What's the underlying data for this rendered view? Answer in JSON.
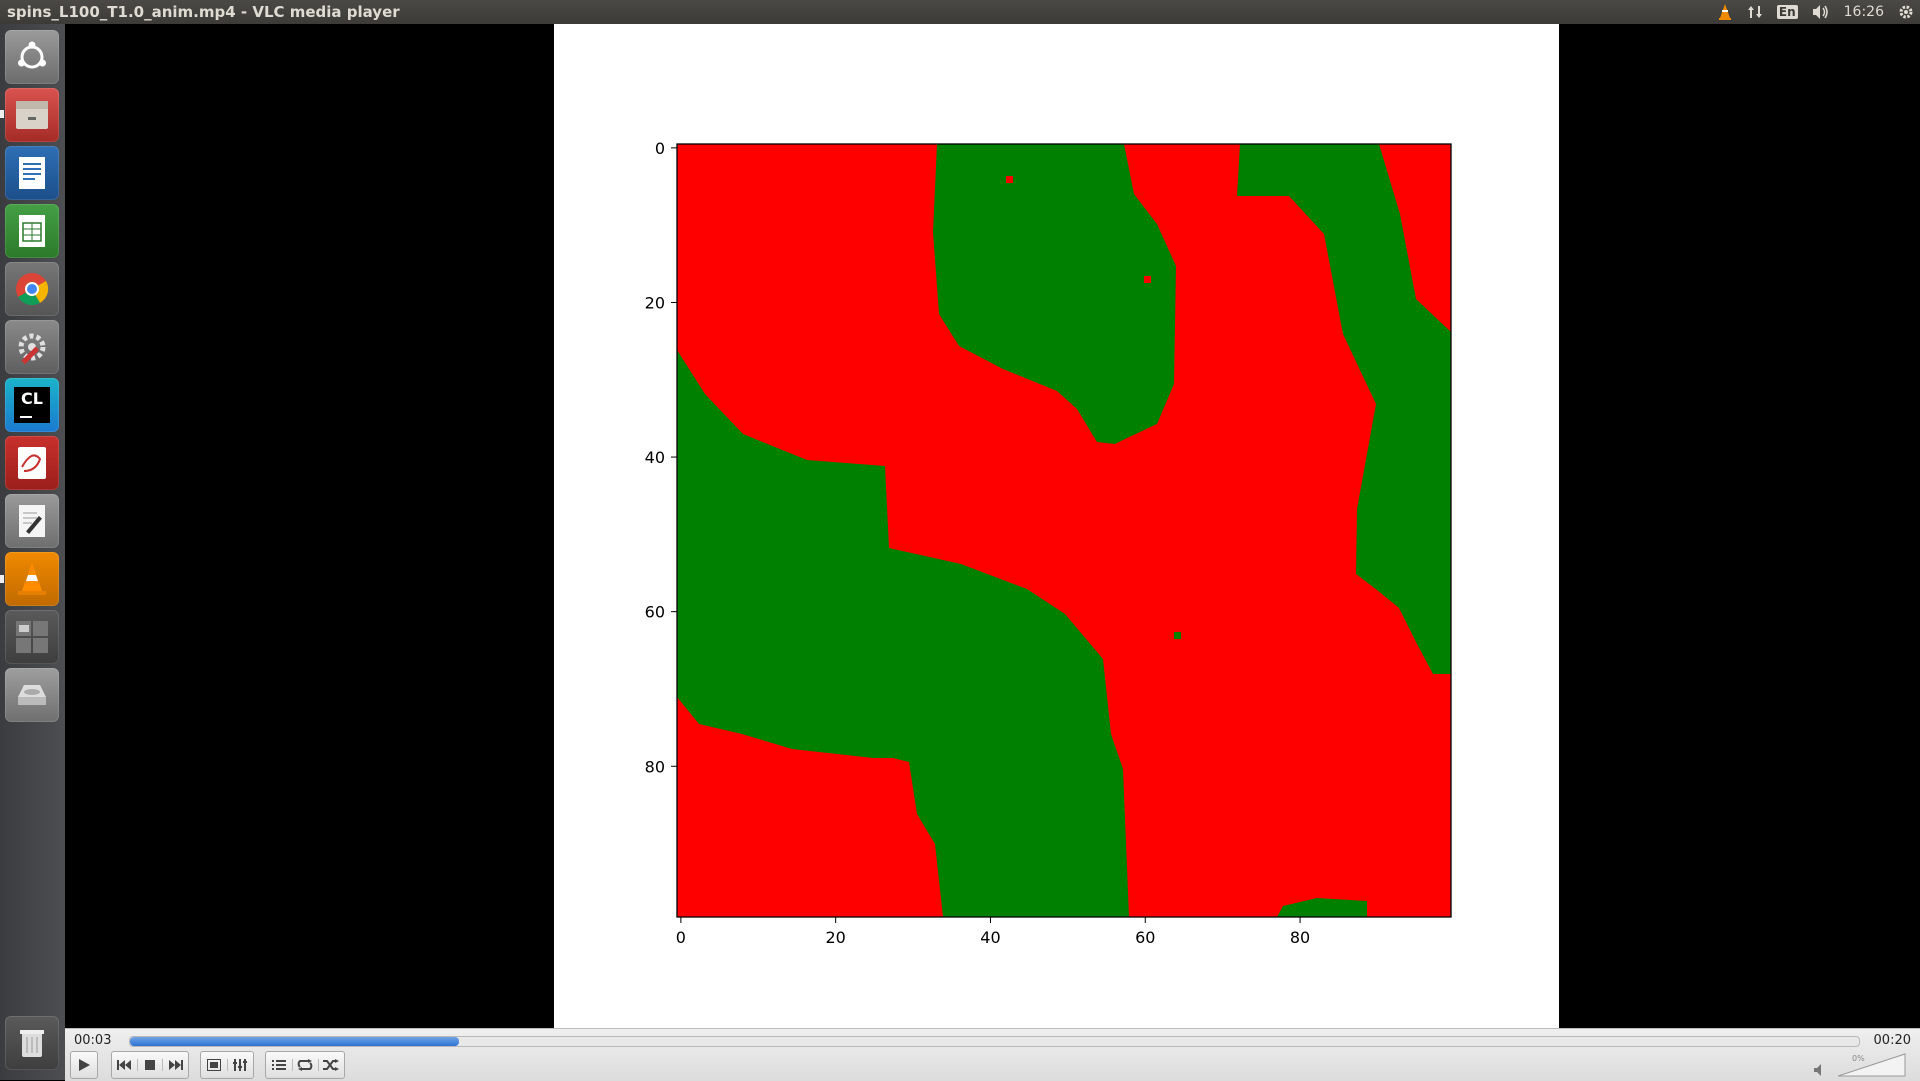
{
  "window": {
    "title": "spins_L100_T1.0_anim.mp4 - VLC media player"
  },
  "tray": {
    "keyboard_layout": "En",
    "clock": "16:26"
  },
  "launcher": {
    "items": [
      {
        "name": "dash-home",
        "icon": "ubuntu-logo-icon"
      },
      {
        "name": "files",
        "icon": "file-cabinet-icon"
      },
      {
        "name": "libreoffice-writer",
        "icon": "document-icon"
      },
      {
        "name": "libreoffice-calc",
        "icon": "spreadsheet-icon"
      },
      {
        "name": "chrome",
        "icon": "chrome-icon"
      },
      {
        "name": "system-settings",
        "icon": "settings-wrench-icon"
      },
      {
        "name": "clion",
        "icon": "clion-icon",
        "label": "CL"
      },
      {
        "name": "evince",
        "icon": "pdf-viewer-icon"
      },
      {
        "name": "text-editor",
        "icon": "text-editor-icon"
      },
      {
        "name": "vlc",
        "icon": "vlc-cone-icon"
      },
      {
        "name": "workspace-switcher",
        "icon": "workspaces-icon"
      },
      {
        "name": "drive",
        "icon": "disk-drive-icon"
      },
      {
        "name": "trash",
        "icon": "trash-icon"
      }
    ]
  },
  "plot": {
    "x_ticks": [
      "0",
      "20",
      "40",
      "60",
      "80"
    ],
    "y_ticks": [
      "0",
      "20",
      "40",
      "60",
      "80"
    ],
    "colors": {
      "spin_up": "#ff0000",
      "spin_down": "#008000"
    }
  },
  "controls": {
    "elapsed": "00:03",
    "total": "00:20",
    "progress_fraction": 0.19,
    "volume_label": "0%"
  }
}
